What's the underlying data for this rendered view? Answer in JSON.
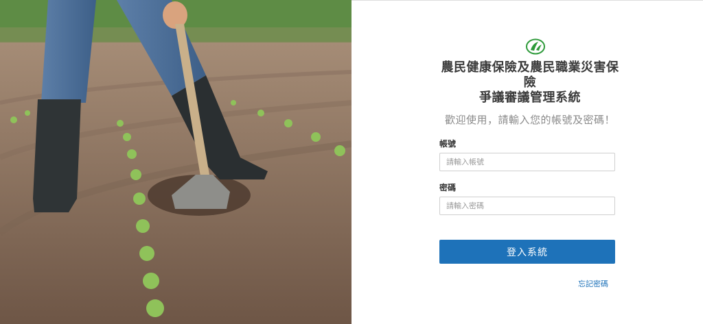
{
  "hero": {
    "image_subject": "farmer hoeing soil in a field with young seedlings"
  },
  "login": {
    "logo_icon": "farm-leaf-logo-icon",
    "title_lines": [
      "農民健康保險及農民職業災害保",
      "險",
      "爭議審議管理系統"
    ],
    "welcome": "歡迎使用，請輸入您的帳號及密碼！",
    "username_label": "帳號",
    "username_placeholder": "請輸入帳號",
    "username_value": "",
    "password_label": "密碼",
    "password_placeholder": "請輸入密碼",
    "password_value": "",
    "login_button": "登入系統",
    "forgot_password": "忘記密碼"
  },
  "colors": {
    "primary": "#1e72b9",
    "logo_green": "#2e9a3a",
    "text": "#3a3a3a",
    "muted": "#8a8a8a"
  }
}
